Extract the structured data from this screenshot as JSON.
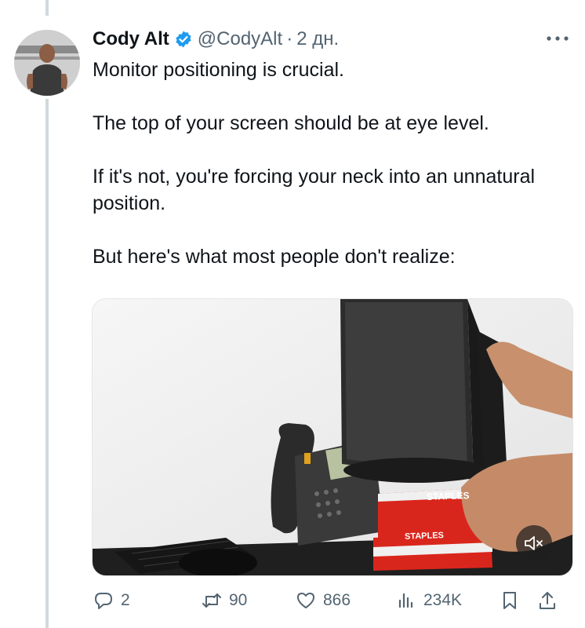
{
  "tweet": {
    "author_name": "Cody Alt",
    "handle": "@CodyAlt",
    "separator": "·",
    "time": "2 дн.",
    "text": "Monitor positioning is crucial.\n\nThe top of your screen should be at eye level.\n\nIf it's not, you're forcing your neck into an unnatural position.\n\nBut here's what most people don't realize:",
    "verified": true
  },
  "media": {
    "box_label_top": "STAPLES",
    "box_label_bottom": "STAPLES",
    "sound_state": "muted"
  },
  "actions": {
    "replies": "2",
    "retweets": "90",
    "likes": "866",
    "views": "234K"
  },
  "colors": {
    "text": "#0f1419",
    "muted": "#536471",
    "verified": "#1d9bf0",
    "staples_red": "#d9261c"
  },
  "icons": [
    "verified-badge-icon",
    "more-icon",
    "reply-icon",
    "retweet-icon",
    "like-icon",
    "views-icon",
    "bookmark-icon",
    "share-icon",
    "mute-icon"
  ]
}
